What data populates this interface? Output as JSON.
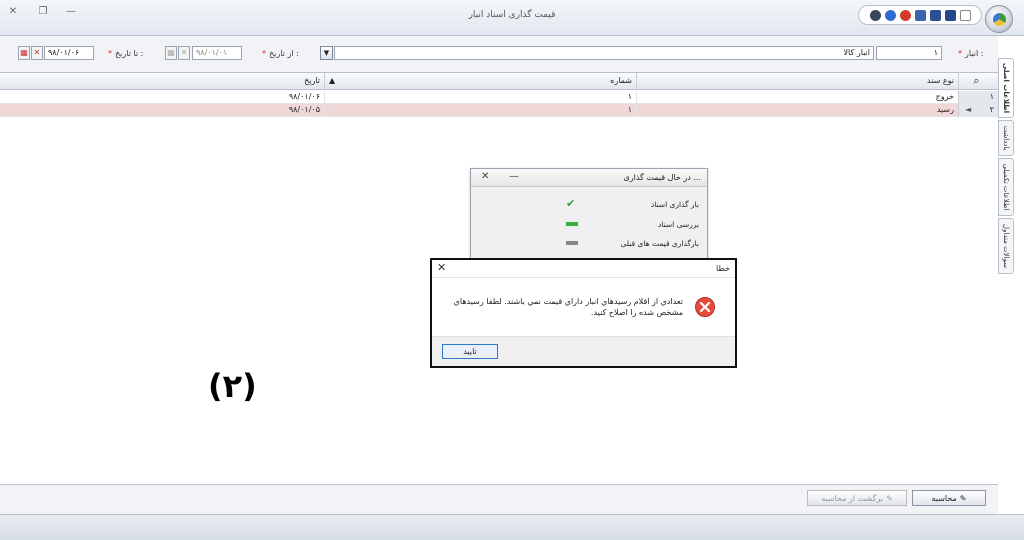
{
  "window": {
    "title": "قیمت گذاری اسناد انبار",
    "minimize_glyph": "—",
    "restore_glyph": "❐",
    "close_glyph": "✕"
  },
  "filter": {
    "warehouse_label": "انبار :",
    "warehouse_code": "۱",
    "warehouse_name": "انبار کالا",
    "from_date_label": "از تاریخ :",
    "from_date_value": "۹۸/۰۱/۰۱",
    "to_date_label": "تا تاریخ :",
    "to_date_value": "۹۸/۰۱/۰۶",
    "required_mark": "*"
  },
  "grid": {
    "columns": [
      "نوع سند",
      "شماره",
      "تاریخ"
    ],
    "rows": [
      {
        "num": "۱",
        "type": "خروج",
        "number": "۱",
        "date": "۹۸/۰۱/۰۶",
        "selected": false
      },
      {
        "num": "۲",
        "type": "رسید",
        "number": "۱",
        "date": "۹۸/۰۱/۰۵",
        "selected": true
      }
    ]
  },
  "side_tabs": [
    "اطلاعات اصلی",
    "یادداشت",
    "اطلاعات تکمیلی",
    "سوالات متداول"
  ],
  "progress": {
    "title": "در حال قیمت گذاری ...",
    "steps": [
      {
        "label": "بار گذاری اسناد",
        "state": "done"
      },
      {
        "label": "بررسی اسناد",
        "state": "active"
      },
      {
        "label": "بارگذاری قیمت های قبلی",
        "state": "pending"
      }
    ]
  },
  "error_dialog": {
    "title": "خطا",
    "message": "تعدادي از اقلام رسيدهاي انبار داراي قيمت نمي باشند. لطفا رسيدهاي مشخص شده را اصلاح کنيد.",
    "ok_label": "تایید"
  },
  "buttons": {
    "calculate": "محاسبه",
    "revert": "برگشت از محاسبه"
  },
  "annotation": "(۲)",
  "colors": {
    "selected_row": "#f1d8d8",
    "error_red": "#e54b3c",
    "ok_border": "#2f76c8"
  }
}
